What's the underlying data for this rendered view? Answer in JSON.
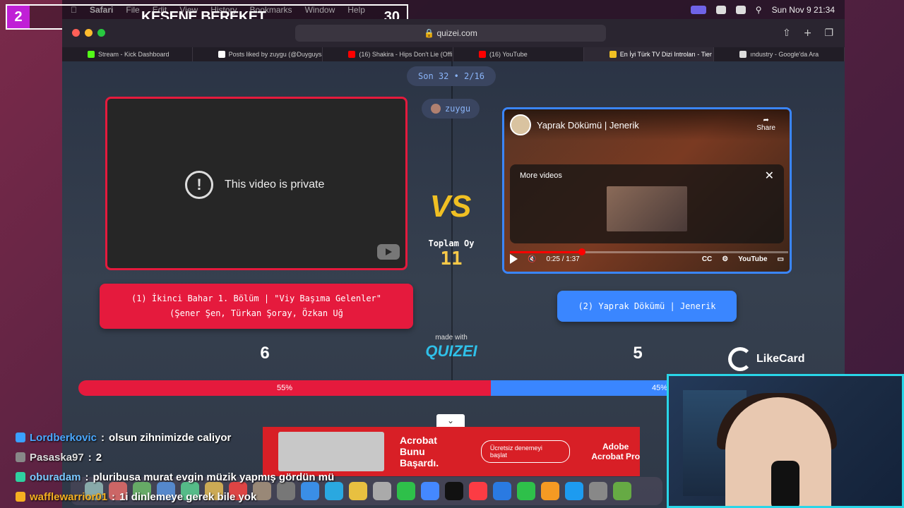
{
  "overlay": {
    "number": "2",
    "title": "KESENE BEREKET",
    "count": "30"
  },
  "menubar": {
    "items": [
      "Safari",
      "File",
      "Edit",
      "View",
      "History",
      "Bookmarks",
      "Window",
      "Help"
    ],
    "datetime": "Sun Nov 9  21:34"
  },
  "browser": {
    "url": "quizei.com",
    "tabs": [
      {
        "label": "Stream - Kick Dashboard",
        "color": "#53fc18"
      },
      {
        "label": "Posts liked by zuygu (@Duyguysa...",
        "color": "#ffffff"
      },
      {
        "label": "(16) Shakira - Hips Don't Lie (Offi...",
        "color": "#ff0000"
      },
      {
        "label": "(16) YouTube",
        "color": "#ff0000"
      },
      {
        "label": "En İyi Türk TV Dizi Introları - Tier L...",
        "color": "#f0c023"
      },
      {
        "label": "ındustry - Google'da Ara",
        "color": "#dddddd"
      }
    ]
  },
  "quiz": {
    "round": "Son 32 • 2/16",
    "user": "zuygu",
    "vs": "VS",
    "total_label": "Toplam Oy",
    "total_value": "11",
    "left": {
      "video_message": "This video is private",
      "option_line1": "(1) İkinci Bahar 1. Bölüm | \"Viy Başıma Gelenler\"",
      "option_line2": "(Şener Şen, Türkan Şoray, Özkan Uğ",
      "score": "6",
      "percent_label": "55%",
      "percent": 55
    },
    "right": {
      "video_title": "Yaprak Dökümü | Jenerik",
      "share_label": "Share",
      "more_videos_label": "More videos",
      "time": "0:25 / 1:37",
      "progress": 0.26,
      "youtube_label": "YouTube",
      "option": "(2) Yaprak Dökümü | Jenerik",
      "score": "5",
      "percent_label": "45%",
      "percent": 45
    },
    "made_with": "made with",
    "brand": "QUIZEI",
    "sponsor": "LikeCard"
  },
  "ad": {
    "headline_1": "Acrobat",
    "headline_2": "Bunu Başardı.",
    "button": "Ücretsiz denemeyi başlat",
    "brand_1": "Adobe",
    "brand_2": "Acrobat Pro"
  },
  "chat": [
    {
      "user": "Lordberkovic",
      "text": "olsun zihnimizde caliyor",
      "color": "#4aa8ff",
      "badge": "#3aa0ff"
    },
    {
      "user": "Pasaska97",
      "text": "2",
      "color": "#dddddd",
      "badge": "#888888"
    },
    {
      "user": "oburadam",
      "text": "pluribusa murat evgin müzik yapmış gördün mü",
      "color": "#7ac8ff",
      "badge": "#2fd0a0"
    },
    {
      "user": "wafflewarrior01",
      "text": "1i dinlemeye gerek bile yok",
      "color": "#f5b021",
      "badge": "#f5b021"
    }
  ]
}
